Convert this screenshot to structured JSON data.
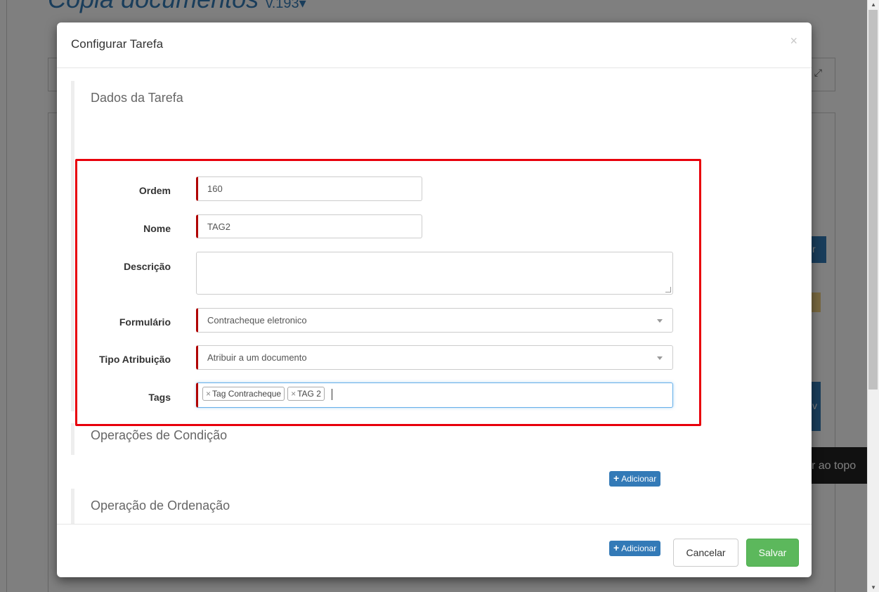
{
  "background": {
    "page_title": "Cópia documentos",
    "version": "v.193",
    "back_to_top": "r ao topo",
    "button_fragment": "r",
    "button_fragment_2": "v"
  },
  "modal": {
    "title": "Configurar Tarefa",
    "close_symbol": "×",
    "section_task": {
      "title": "Dados da Tarefa",
      "fields": {
        "ordem": {
          "label": "Ordem",
          "value": "160"
        },
        "nome": {
          "label": "Nome",
          "value": "TAG2"
        },
        "descricao": {
          "label": "Descrição",
          "value": ""
        },
        "formulario": {
          "label": "Formulário",
          "value": "Contracheque eletronico"
        },
        "tipo_atribuicao": {
          "label": "Tipo Atribuição",
          "value": "Atribuir a um documento"
        },
        "tags": {
          "label": "Tags",
          "chips": [
            "Tag Contracheque",
            "TAG 2"
          ],
          "remove_symbol": "×"
        }
      }
    },
    "section_conditions": {
      "title": "Operações de Condição",
      "add_label": "Adicionar"
    },
    "section_ordering": {
      "title": "Operação de Ordenação",
      "add_label": "Adicionar"
    },
    "footer": {
      "cancel_label": "Cancelar",
      "save_label": "Salvar"
    }
  },
  "colors": {
    "primary": "#337ab7",
    "success": "#5cb85c",
    "required_marker": "#b00000",
    "highlight": "#e8000b"
  },
  "icons": [
    "close-icon",
    "plus-icon",
    "caret-down-icon",
    "resize-grip-icon",
    "expand-icon"
  ]
}
